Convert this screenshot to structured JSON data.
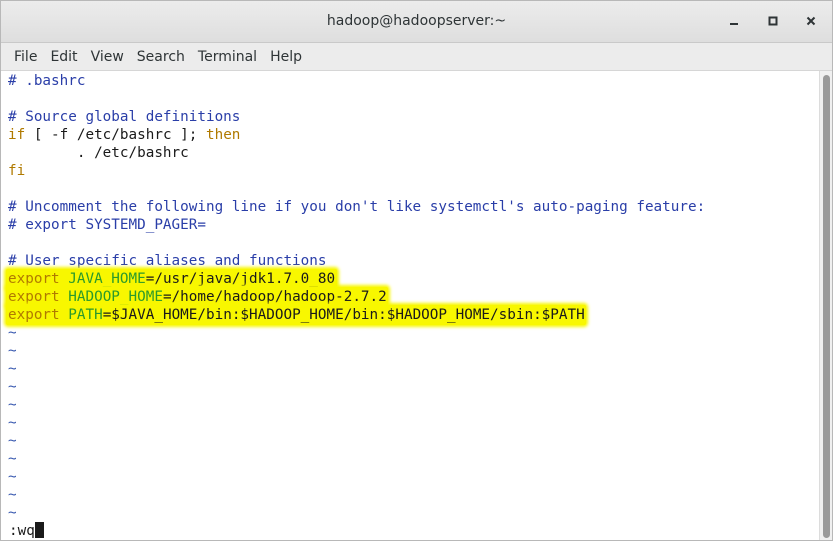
{
  "window": {
    "title": "hadoop@hadoopserver:~",
    "controls": {
      "minimize": "minimize-icon",
      "maximize": "maximize-icon",
      "close": "close-icon"
    }
  },
  "menubar": {
    "items": [
      "File",
      "Edit",
      "View",
      "Search",
      "Terminal",
      "Help"
    ]
  },
  "editor": {
    "lines": [
      {
        "type": "comment",
        "text": "# .bashrc"
      },
      {
        "type": "blank",
        "text": ""
      },
      {
        "type": "comment",
        "text": "# Source global definitions"
      },
      {
        "type": "if",
        "kw1": "if",
        "mid": " [ -f /etc/bashrc ]; ",
        "kw2": "then"
      },
      {
        "type": "plain",
        "text": "        . /etc/bashrc"
      },
      {
        "type": "kw",
        "text": "fi"
      },
      {
        "type": "blank",
        "text": ""
      },
      {
        "type": "comment",
        "text": "# Uncomment the following line if you don't like systemctl's auto-paging feature:"
      },
      {
        "type": "comment",
        "text": "# export SYSTEMD_PAGER="
      },
      {
        "type": "blank",
        "text": ""
      },
      {
        "type": "comment",
        "text": "# User specific aliases and functions"
      },
      {
        "type": "export",
        "kw": "export",
        "var": "JAVA_HOME",
        "value": "=/usr/java/jdk1.7.0_80",
        "highlight": true
      },
      {
        "type": "export",
        "kw": "export",
        "var": "HADOOP_HOME",
        "value": "=/home/hadoop/hadoop-2.7.2",
        "highlight": true
      },
      {
        "type": "export",
        "kw": "export",
        "var": "PATH",
        "value": "=$JAVA_HOME/bin:$HADOOP_HOME/bin:$HADOOP_HOME/sbin:$PATH",
        "highlight": true
      }
    ],
    "tilde": "~",
    "tilde_count": 11,
    "command_line": ":wq"
  },
  "colors": {
    "highlight": "#f8f700",
    "comment": "#2a3ea8",
    "keyword": "#b07a00",
    "variable": "#2b9a2b"
  }
}
